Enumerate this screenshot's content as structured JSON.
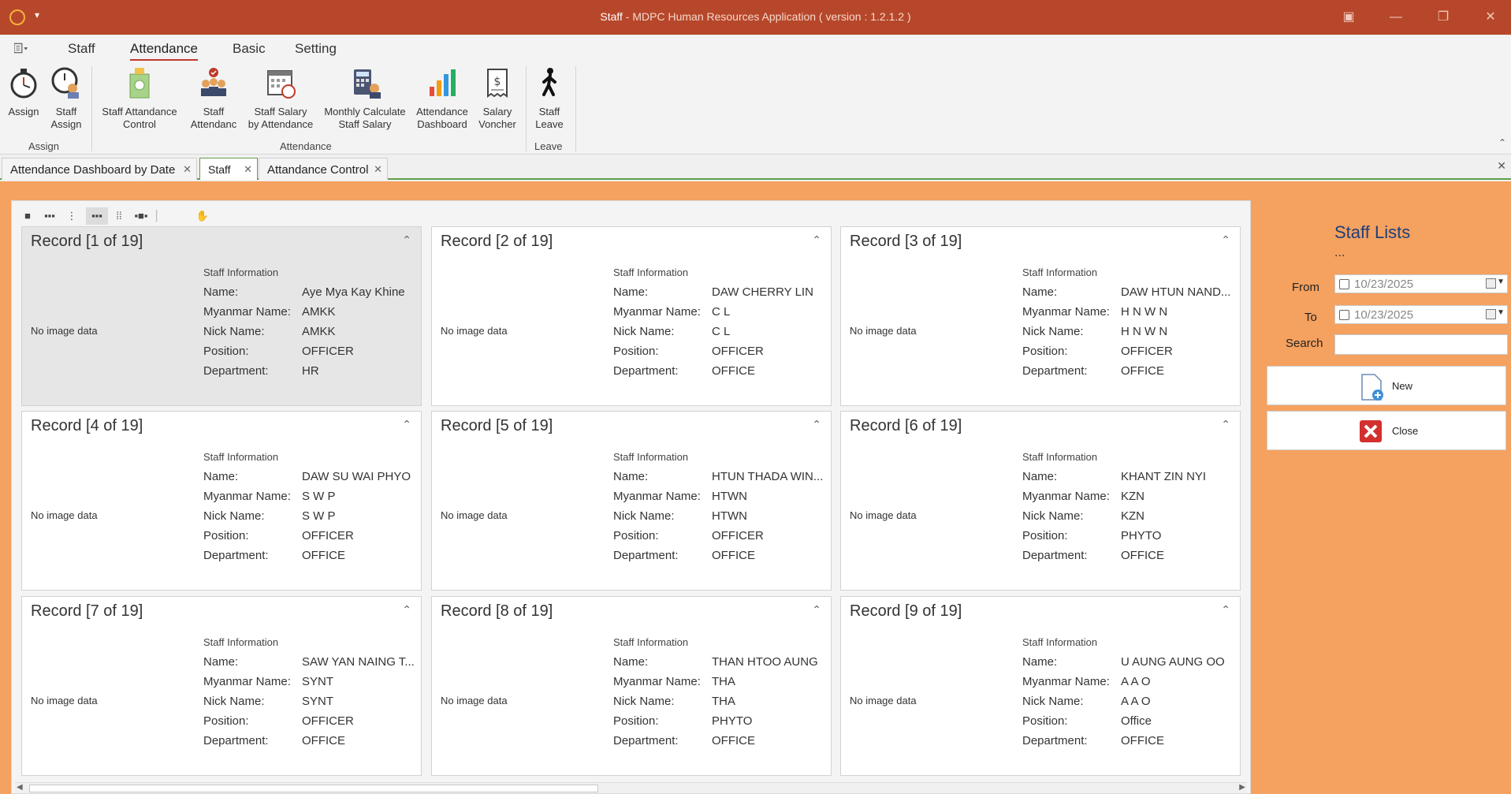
{
  "window": {
    "title_main": "Staff",
    "title_sub": " - MDPC Human Resources Application ( version : 1.2.1.2 )"
  },
  "menu": {
    "items": [
      "Staff",
      "Attendance",
      "Basic",
      "Setting"
    ],
    "active": "Attendance"
  },
  "ribbon": {
    "buttons": [
      {
        "line1": "Assign",
        "line2": "",
        "icon": "stopwatch-icon"
      },
      {
        "line1": "Staff",
        "line2": "Assign",
        "icon": "staff-clock-icon"
      },
      {
        "line1": "Staff Attandance",
        "line2": "Control",
        "icon": "calculator-icon"
      },
      {
        "line1": "Staff",
        "line2": "Attendanc",
        "icon": "team-check-icon"
      },
      {
        "line1": "Staff Salary",
        "line2": "by Attendance",
        "icon": "calendar-clock-icon"
      },
      {
        "line1": "Monthly Calculate",
        "line2": "Staff Salary",
        "icon": "calculator-person-icon"
      },
      {
        "line1": "Attendance",
        "line2": "Dashboard",
        "icon": "bar-chart-icon"
      },
      {
        "line1": "Salary",
        "line2": "Voncher",
        "icon": "receipt-icon"
      },
      {
        "line1": "Staff",
        "line2": "Leave",
        "icon": "walking-person-icon"
      }
    ],
    "groups": [
      "Assign",
      "Attendance",
      "Leave"
    ]
  },
  "tabs": [
    {
      "label": "Attendance Dashboard by Date"
    },
    {
      "label": "Staff"
    },
    {
      "label": "Attandance Control"
    }
  ],
  "cards_labels": {
    "section": "Staff Information",
    "name": "Name:",
    "myanmar": "Myanmar Name:",
    "nick": "Nick Name:",
    "position": "Position:",
    "department": "Department:",
    "noimage": "No image data"
  },
  "records": [
    {
      "title": "Record [1 of 19]",
      "name": "Aye Mya Kay Khine",
      "myanmar": "AMKK",
      "nick": "AMKK",
      "position": "OFFICER",
      "department": "HR"
    },
    {
      "title": "Record [2 of 19]",
      "name": "DAW CHERRY LIN",
      "myanmar": "C L",
      "nick": "C L",
      "position": "OFFICER",
      "department": "OFFICE"
    },
    {
      "title": "Record [3 of 19]",
      "name": "DAW HTUN NAND...",
      "myanmar": "H N W N",
      "nick": "H N W N",
      "position": "OFFICER",
      "department": "OFFICE"
    },
    {
      "title": "Record [4 of 19]",
      "name": "DAW SU WAI PHYO",
      "myanmar": "S W P",
      "nick": "S W P",
      "position": "OFFICER",
      "department": "OFFICE"
    },
    {
      "title": "Record [5 of 19]",
      "name": "HTUN THADA WIN...",
      "myanmar": "HTWN",
      "nick": "HTWN",
      "position": "OFFICER",
      "department": "OFFICE"
    },
    {
      "title": "Record [6 of 19]",
      "name": "KHANT ZIN NYI",
      "myanmar": "KZN",
      "nick": "KZN",
      "position": "PHYTO",
      "department": "OFFICE"
    },
    {
      "title": "Record [7 of 19]",
      "name": "SAW YAN NAING T...",
      "myanmar": "SYNT",
      "nick": "SYNT",
      "position": "OFFICER",
      "department": "OFFICE"
    },
    {
      "title": "Record [8 of 19]",
      "name": "THAN HTOO AUNG",
      "myanmar": "THA",
      "nick": "THA",
      "position": "PHYTO",
      "department": "OFFICE"
    },
    {
      "title": "Record [9 of 19]",
      "name": "U AUNG AUNG OO",
      "myanmar": "A A O",
      "nick": "A A O",
      "position": "Office",
      "department": "OFFICE"
    }
  ],
  "side": {
    "title": "Staff Lists",
    "dots": "...",
    "from_label": "From",
    "to_label": "To",
    "search_label": "Search",
    "from_date": "10/23/2025",
    "to_date": "10/23/2025",
    "search_value": "",
    "new_label": "New",
    "close_label": "Close"
  },
  "colors": {
    "titlebar": "#b7472a",
    "content_bg": "#f5a15f",
    "accent_tab": "#5fa04a"
  }
}
